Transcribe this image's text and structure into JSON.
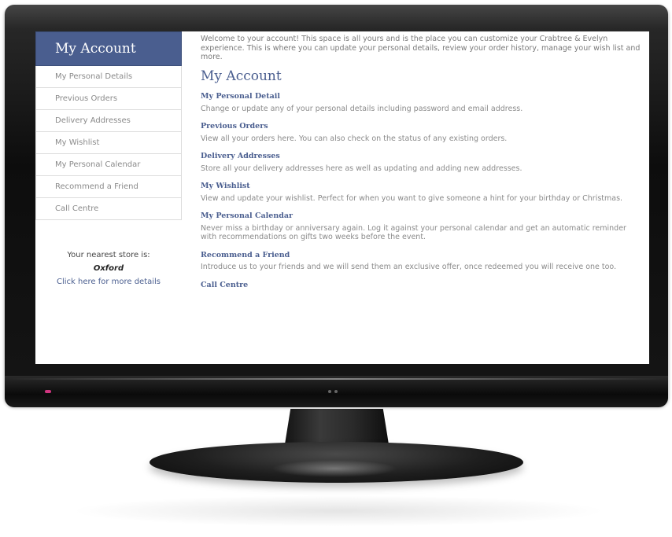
{
  "sidebar": {
    "title": "My Account",
    "items": [
      {
        "label": "My Personal Details"
      },
      {
        "label": "Previous Orders"
      },
      {
        "label": "Delivery Addresses"
      },
      {
        "label": "My Wishlist"
      },
      {
        "label": "My Personal Calendar"
      },
      {
        "label": "Recommend a Friend"
      },
      {
        "label": "Call Centre"
      }
    ],
    "store": {
      "label": "Your nearest store is:",
      "name": "Oxford",
      "link": "Click here for more details"
    }
  },
  "main": {
    "welcome": "Welcome to your account! This space is all yours and is the place you can customize your Crabtree & Evelyn experience. This is where you can update your personal details, review your order history, manage your wish list and more.",
    "heading": "My Account",
    "sections": [
      {
        "title": "My Personal Detail",
        "desc": "Change or update any of your personal details including password and email address."
      },
      {
        "title": "Previous Orders",
        "desc": "View all your orders here. You can also check on the status of any existing orders."
      },
      {
        "title": "Delivery Addresses",
        "desc": "Store all your delivery addresses here as well as updating and adding new addresses."
      },
      {
        "title": "My Wishlist",
        "desc": "View and update your wishlist. Perfect for when you want to give someone a hint for your birthday or Christmas."
      },
      {
        "title": "My Personal Calendar",
        "desc": "Never miss a birthday or anniversary again. Log it against your personal calendar and get an automatic reminder with recommendations on gifts two weeks before the event."
      },
      {
        "title": "Recommend a Friend",
        "desc": "Introduce us to your friends and we will send them an exclusive offer, once redeemed you will receive one too."
      },
      {
        "title": "Call Centre",
        "desc": ""
      }
    ]
  },
  "colors": {
    "accent": "#4a5e8f",
    "power_led": "#d0357f"
  }
}
